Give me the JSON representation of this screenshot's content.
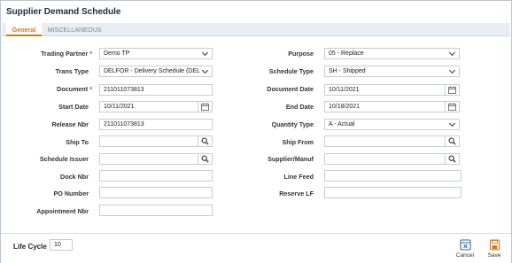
{
  "window": {
    "title": "Supplier Demand Schedule"
  },
  "tabs": [
    {
      "label": "General"
    },
    {
      "label": "MISCELLANEOUS"
    }
  ],
  "form": {
    "trading_partner": {
      "label": "Trading Partner",
      "value": "Demo TP",
      "required": true
    },
    "trans_type": {
      "label": "Trans Type",
      "value": "DELFOR - Delivery Schedule (DEL"
    },
    "document": {
      "label": "Document",
      "value": "211011073813",
      "required": true
    },
    "start_date": {
      "label": "Start Date",
      "value": "10/11/2021"
    },
    "release_nbr": {
      "label": "Release Nbr",
      "value": "211011073813"
    },
    "ship_to": {
      "label": "Ship To",
      "value": ""
    },
    "schedule_issuer": {
      "label": "Schedule Issuer",
      "value": ""
    },
    "dock_nbr": {
      "label": "Dock Nbr",
      "value": ""
    },
    "po_number": {
      "label": "PO Number",
      "value": ""
    },
    "appointment_nbr": {
      "label": "Appointment Nbr",
      "value": ""
    },
    "purpose": {
      "label": "Purpose",
      "value": "05 - Replace"
    },
    "schedule_type": {
      "label": "Schedule Type",
      "value": "SH - Shipped"
    },
    "document_date": {
      "label": "Document Date",
      "value": "10/11/2021"
    },
    "end_date": {
      "label": "End Date",
      "value": "10/18/2021"
    },
    "quantity_type": {
      "label": "Quantity Type",
      "value": "A - Actual"
    },
    "ship_from": {
      "label": "Ship From",
      "value": ""
    },
    "supplier_manuf": {
      "label": "Supplier/Manuf",
      "value": ""
    },
    "line_feed": {
      "label": "Line Feed",
      "value": ""
    },
    "reserve_lf": {
      "label": "Reserve LF",
      "value": ""
    }
  },
  "footer": {
    "life_cycle": {
      "label": "Life Cycle",
      "value": "10"
    },
    "cancel_label": "Cancel",
    "save_label": "Save"
  },
  "icons": {
    "dropdown": "chevron-down-icon",
    "calendar": "calendar-icon",
    "search": "search-icon",
    "cancel": "cancel-icon",
    "save": "save-icon"
  },
  "colors": {
    "accent": "#d1781f",
    "required": "#d53030",
    "border": "#c7cdd3",
    "tabbar": "#e9edf1"
  }
}
